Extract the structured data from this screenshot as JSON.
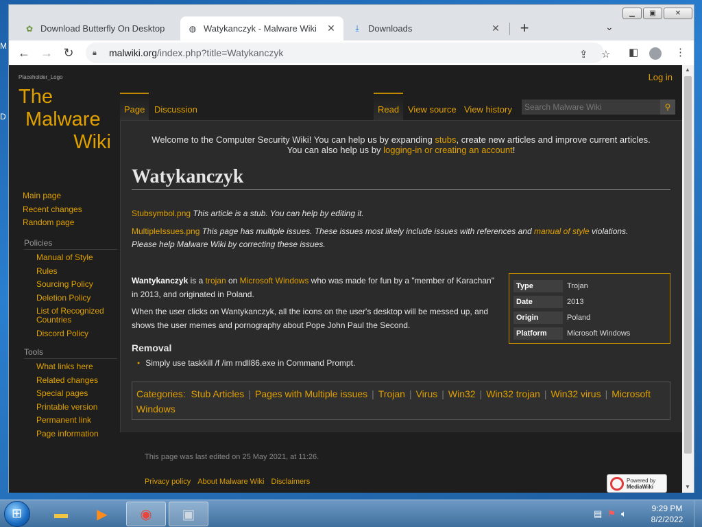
{
  "browser": {
    "tabs": [
      {
        "title": "Download Butterfly On Desktop",
        "favicon": "butterfly-icon"
      },
      {
        "title": "Watykanczyk - Malware Wiki",
        "favicon": "globe-icon"
      },
      {
        "title": "Downloads",
        "favicon": "download-icon"
      }
    ],
    "url_host": "malwiki.org",
    "url_path": "/index.php?title=Watykanczyk"
  },
  "wiki": {
    "logo_caption": "Placeholder_Logo",
    "logo_lines": [
      "The",
      "Malware",
      "Wiki"
    ],
    "login": "Log in",
    "nav_main": [
      "Main page",
      "Recent changes",
      "Random page"
    ],
    "policies_heading": "Policies",
    "policies": [
      "Manual of Style",
      "Rules",
      "Sourcing Policy",
      "Deletion Policy",
      "List of Recognized Countries",
      "Discord Policy"
    ],
    "tools_heading": "Tools",
    "tools": [
      "What links here",
      "Related changes",
      "Special pages",
      "Printable version",
      "Permanent link",
      "Page information"
    ],
    "tabs_left": [
      "Page",
      "Discussion"
    ],
    "tabs_right": [
      "Read",
      "View source",
      "View history"
    ],
    "search_placeholder": "Search Malware Wiki",
    "sitenotice": {
      "l1_a": "Welcome to the Computer Security Wiki! You can help us by expanding ",
      "l1_link": "stubs",
      "l1_b": ", create new articles and improve current articles.",
      "l2_a": "You can also help us by ",
      "l2_link": "logging-in or creating an account",
      "l2_b": "!"
    },
    "page_title": "Watykanczyk",
    "stub_img": "Stubsymbol.png",
    "stub_text": "This article is a stub. You can help by editing it.",
    "multi_img": "MultipleIssues.png",
    "multi_text_a": "This page has multiple issues. These issues most likely include issues with references and ",
    "multi_link": "manual of style",
    "multi_text_b": " violations.",
    "multi_text_c": "Please help Malware Wiki by correcting these issues.",
    "para1": {
      "bold": "Wantykanczyk",
      "t1": " is a ",
      "l1": "trojan",
      "t2": " on ",
      "l2": "Microsoft Windows",
      "t3": " who was made for fun by a \"member of Karachan\" in 2013, and originated in Poland."
    },
    "para2": "When the user clicks on Wantykanczyk, all the icons on the user's desktop will be messed up, and shows the user memes and pornography about Pope John Paul the Second.",
    "infobox": [
      {
        "k": "Type",
        "v": "Trojan"
      },
      {
        "k": "Date",
        "v": "2013"
      },
      {
        "k": "Origin",
        "v": "Poland"
      },
      {
        "k": "Platform",
        "v": "Microsoft Windows"
      }
    ],
    "removal_heading": "Removal",
    "removal_item": "Simply use taskkill /f /im rndll86.exe in Command Prompt.",
    "categories_label": "Categories:",
    "categories": [
      "Stub Articles",
      "Pages with Multiple issues",
      "Trojan",
      "Virus",
      "Win32",
      "Win32 trojan",
      "Win32 virus",
      "Microsoft Windows"
    ],
    "last_edited": "This page was last edited on 25 May 2021, at 11:26.",
    "footer_links": [
      "Privacy policy",
      "About Malware Wiki",
      "Disclaimers"
    ],
    "powered_by_l1": "Powered by",
    "powered_by_l2": "MediaWiki"
  },
  "taskbar": {
    "time": "9:29 PM",
    "date": "8/2/2022"
  }
}
